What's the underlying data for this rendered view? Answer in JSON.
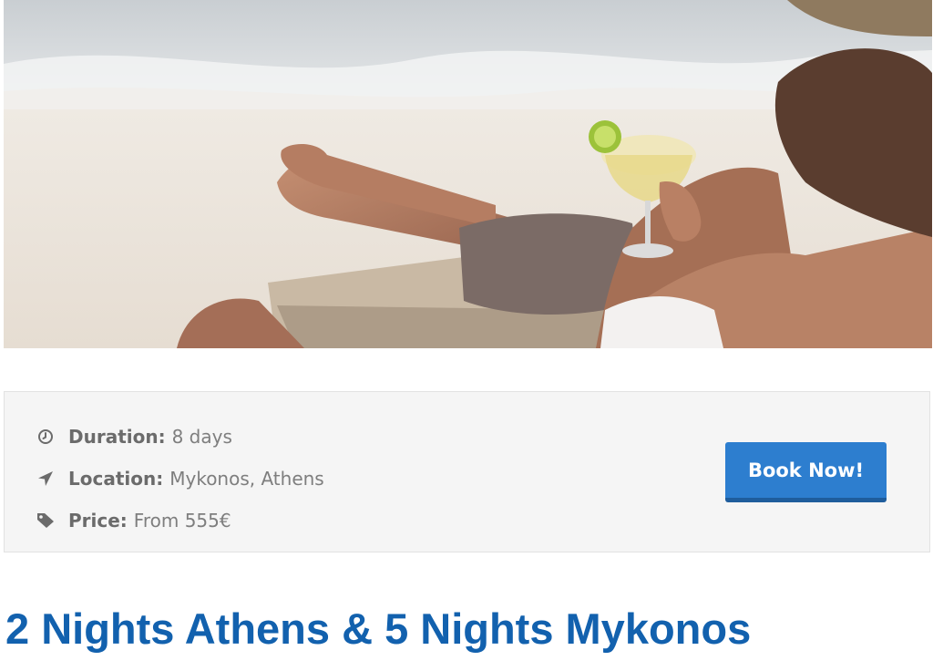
{
  "hero": {
    "image_name": "beach-relaxation-photo"
  },
  "info": {
    "items": [
      {
        "icon": "clock-icon",
        "label": "Duration:",
        "value": "8 days"
      },
      {
        "icon": "location-arrow-icon",
        "label": "Location:",
        "value": "Mykonos, Athens"
      },
      {
        "icon": "price-tag-icon",
        "label": "Price:",
        "value": "From 555€"
      }
    ],
    "book_label": "Book Now!"
  },
  "title": "2 Nights Athens & 5 Nights Mykonos",
  "colors": {
    "accent": "#2d7ecf",
    "title": "#1261ae",
    "info_bg": "#f5f5f5",
    "icon": "#6b6b6b"
  }
}
